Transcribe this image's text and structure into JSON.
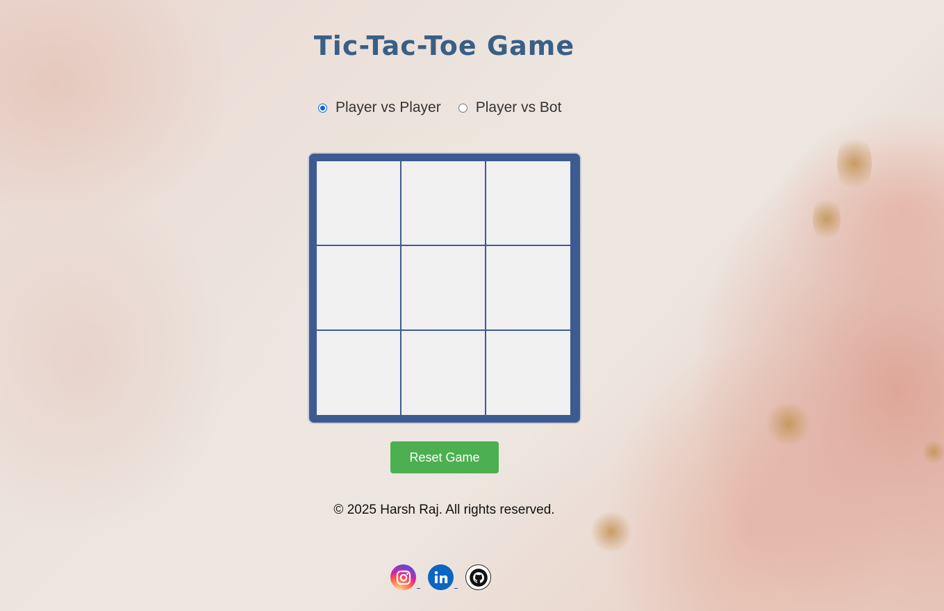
{
  "page": {
    "title": "Tic-Tac-Toe Game"
  },
  "modes": [
    {
      "label": "Player vs Player",
      "selected": true
    },
    {
      "label": "Player vs Bot",
      "selected": false
    }
  ],
  "board": {
    "cells": [
      "",
      "",
      "",
      "",
      "",
      "",
      "",
      "",
      ""
    ]
  },
  "controls": {
    "reset_label": "Reset Game"
  },
  "footer": {
    "copyright": "© 2025 Harsh Raj. All rights reserved."
  },
  "social": [
    {
      "icon": "instagram-icon"
    },
    {
      "icon": "linkedin-icon"
    },
    {
      "icon": "github-icon"
    }
  ],
  "colors": {
    "title": "#3a5f86",
    "board": "#3d5a91",
    "cell": "#f0f0f0",
    "reset_button": "#4caf50"
  }
}
